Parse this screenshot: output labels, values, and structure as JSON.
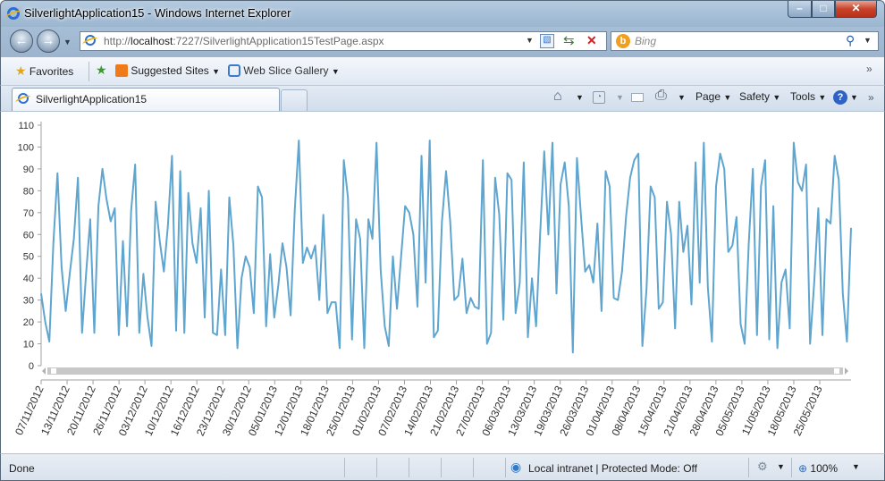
{
  "window": {
    "title": "SilverlightApplication15 - Windows Internet Explorer"
  },
  "address": {
    "prefix": "http://",
    "host": "localhost",
    "rest": ":7227/SilverlightApplication15TestPage.aspx"
  },
  "search": {
    "placeholder": "Bing"
  },
  "favorites": {
    "favorites_label": "Favorites",
    "suggested_label": "Suggested Sites",
    "webslice_label": "Web Slice Gallery"
  },
  "tab": {
    "title": "SilverlightApplication15"
  },
  "commands": {
    "page": "Page",
    "safety": "Safety",
    "tools": "Tools"
  },
  "status": {
    "text": "Done",
    "zone": "Local intranet | Protected Mode: Off",
    "zoom": "100%"
  },
  "icons": [
    "ie-logo-icon",
    "back-arrow-icon",
    "forward-arrow-icon",
    "compatibility-icon",
    "refresh-icon",
    "stop-icon",
    "bing-icon",
    "search-icon",
    "favorites-star-icon",
    "add-favorites-icon",
    "suggested-sites-icon",
    "web-slice-icon",
    "home-icon",
    "rss-icon",
    "mail-icon",
    "print-icon",
    "help-icon",
    "globe-icon",
    "zoom-icon"
  ],
  "colors": {
    "series": "#5ea5d0",
    "accent": "#2b6fd6"
  },
  "chart_data": {
    "type": "line",
    "ylim": [
      0,
      110
    ],
    "yticks": [
      0,
      10,
      20,
      30,
      40,
      50,
      60,
      70,
      80,
      90,
      100,
      110
    ],
    "xlim": [
      "07/11/2012",
      "29/05/2013"
    ],
    "xtick_labels": [
      "07/11/2012",
      "13/11/2012",
      "20/11/2012",
      "26/11/2012",
      "03/12/2012",
      "10/12/2012",
      "16/12/2012",
      "23/12/2012",
      "30/12/2012",
      "05/01/2013",
      "12/01/2013",
      "18/01/2013",
      "25/01/2013",
      "01/02/2013",
      "07/02/2013",
      "14/02/2013",
      "21/02/2013",
      "27/02/2013",
      "06/03/2013",
      "13/03/2013",
      "19/03/2013",
      "26/03/2013",
      "01/04/2013",
      "08/04/2013",
      "15/04/2013",
      "21/04/2013",
      "28/04/2013",
      "05/05/2013",
      "11/05/2013",
      "18/05/2013",
      "25/05/2013"
    ],
    "series": [
      {
        "values": [
          33,
          20,
          11,
          56,
          88,
          45,
          25,
          42,
          58,
          86,
          15,
          42,
          67,
          15,
          73,
          90,
          76,
          66,
          72,
          14,
          57,
          18,
          71,
          92,
          15,
          42,
          22,
          9,
          75,
          57,
          43,
          64,
          96,
          16,
          89,
          15,
          79,
          56,
          47,
          72,
          22,
          80,
          15,
          14,
          44,
          14,
          77,
          55,
          8,
          40,
          50,
          45,
          24,
          82,
          77,
          18,
          51,
          22,
          37,
          56,
          45,
          23,
          71,
          103,
          47,
          54,
          49,
          55,
          30,
          69,
          24,
          29,
          29,
          8,
          94,
          77,
          12,
          67,
          58,
          8,
          67,
          58,
          102,
          44,
          18,
          9,
          50,
          26,
          50,
          73,
          70,
          60,
          27,
          96,
          38,
          103,
          13,
          16,
          66,
          89,
          66,
          30,
          32,
          49,
          24,
          31,
          27,
          26,
          94,
          10,
          15,
          86,
          69,
          21,
          88,
          85,
          24,
          38,
          93,
          13,
          40,
          18,
          60,
          98,
          60,
          102,
          33,
          83,
          93,
          73,
          6,
          95,
          68,
          43,
          46,
          38,
          65,
          25,
          89,
          82,
          31,
          30,
          43,
          68,
          86,
          94,
          97,
          9,
          35,
          82,
          77,
          26,
          29,
          75,
          60,
          17,
          75,
          52,
          64,
          28,
          93,
          38,
          102,
          36,
          11,
          82,
          97,
          90,
          52,
          55,
          68,
          19,
          10,
          56,
          90,
          14,
          82,
          94,
          12,
          73,
          8,
          38,
          44,
          17,
          102,
          84,
          80,
          92,
          10,
          38,
          72,
          14,
          67,
          65,
          96,
          85,
          33,
          11,
          63
        ]
      }
    ]
  }
}
